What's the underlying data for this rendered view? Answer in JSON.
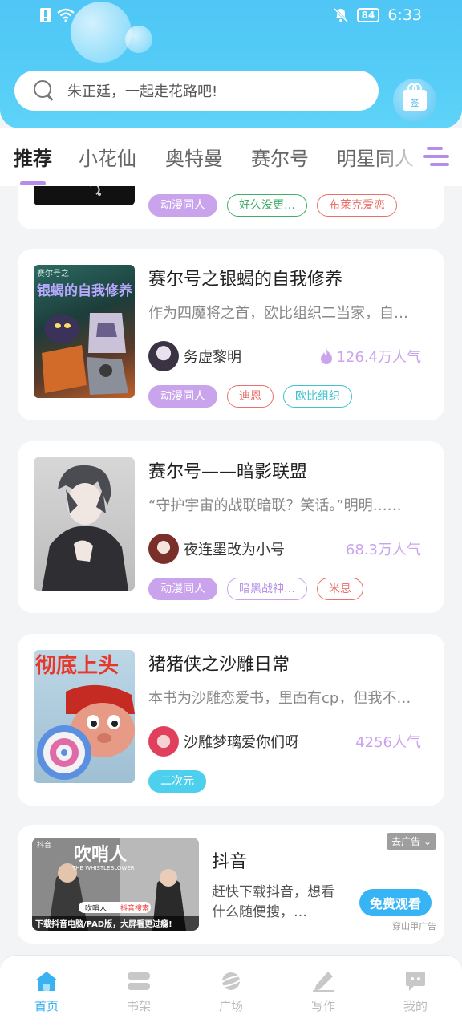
{
  "status_bar": {
    "battery": "84",
    "time": "6:33"
  },
  "search": {
    "placeholder": "朱正廷，一起走花路吧!"
  },
  "gift": {
    "label": "签"
  },
  "tabs": [
    {
      "label": "推荐",
      "active": true
    },
    {
      "label": "小花仙"
    },
    {
      "label": "奥特曼"
    },
    {
      "label": "赛尔号"
    },
    {
      "label": "明星同人"
    }
  ],
  "partial_card": {
    "tags": [
      {
        "label": "动漫同人",
        "color": "#b68de6"
      },
      {
        "label": "好久没更…",
        "color": "#3fae6a"
      },
      {
        "label": "布莱克爱恋",
        "color": "#e8726b"
      }
    ]
  },
  "cards": [
    {
      "title": "赛尔号之银蝎的自我修养",
      "description": "作为四魔将之首，欧比组织二当家，自…",
      "cover_text": "赛尔号之 银蝎的自我修养",
      "author": "务虚黎明",
      "popularity": "126.4万人气",
      "popularity_icon": "flame-icon",
      "tags": [
        {
          "label": "动漫同人",
          "color": "#b68de6"
        },
        {
          "label": "迪恩",
          "color": "#e8726b"
        },
        {
          "label": "欧比组织",
          "color": "#3fc1cf"
        }
      ]
    },
    {
      "title": "赛尔号——暗影联盟",
      "description": "“守护宇宙的战联暗联？笑话。”明明……",
      "author": "夜连墨改为小号",
      "popularity": "68.3万人气",
      "tags": [
        {
          "label": "动漫同人",
          "color": "#b68de6"
        },
        {
          "label": "暗黑战神…",
          "color": "#b68de6"
        },
        {
          "label": "米息",
          "color": "#e8726b"
        }
      ]
    },
    {
      "title": "猪猪侠之沙雕日常",
      "description": "本书为沙雕恋爱书，里面有cp，但我不…",
      "cover_text": "彻底上头",
      "author": "沙雕梦璃爱你们呀",
      "popularity": "4256人气",
      "tags": [
        {
          "label": "二次元",
          "color": "#3fc1e0",
          "filled": true
        }
      ]
    }
  ],
  "ad": {
    "label": "去广告",
    "title": "抖音",
    "description": "赶快下载抖音，想看什么随便搜，…",
    "cta": "免费观看",
    "source": "穿山甲广告",
    "image_brand": "抖音",
    "image_title": "吹哨人",
    "image_subtitle": "THE WHISTLEBLOWER",
    "image_search": "吹哨人",
    "image_search_btn": "抖音搜索",
    "image_caption": "下载抖音电脑/PAD版，大屏看更过瘾!"
  },
  "bottom_nav": [
    {
      "label": "首页",
      "icon": "home-icon",
      "active": true
    },
    {
      "label": "书架",
      "icon": "bookshelf-icon"
    },
    {
      "label": "广场",
      "icon": "planet-icon"
    },
    {
      "label": "写作",
      "icon": "pen-icon"
    },
    {
      "label": "我的",
      "icon": "profile-icon"
    }
  ],
  "colors": {
    "header": "#4fc6f5",
    "accent_purple": "#b68de6",
    "popularity_purple": "#c9a4ec",
    "nav_active": "#39b2f2"
  }
}
